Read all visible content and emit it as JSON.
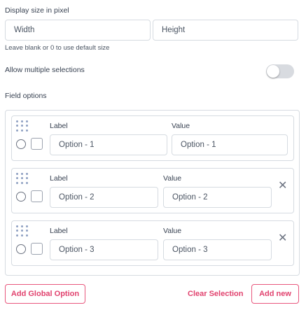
{
  "display_size": {
    "title": "Display size in pixel",
    "width_placeholder": "Width",
    "height_placeholder": "Height",
    "help": "Leave blank or 0 to use default size"
  },
  "multiple": {
    "label": "Allow multiple selections",
    "enabled": false
  },
  "field_options": {
    "title": "Field options",
    "label_header": "Label",
    "value_header": "Value",
    "options": [
      {
        "label": "Option - 1",
        "value": "Option - 1"
      },
      {
        "label": "Option - 2",
        "value": "Option - 2"
      },
      {
        "label": "Option - 3",
        "value": "Option - 3"
      }
    ]
  },
  "footer": {
    "add_global": "Add Global Option",
    "clear_selection": "Clear Selection",
    "add_new": "Add new"
  },
  "icons": {
    "close": "close-icon",
    "drag": "drag-handle-icon"
  },
  "colors": {
    "accent": "#e1426e",
    "border": "#d6dbe1"
  }
}
